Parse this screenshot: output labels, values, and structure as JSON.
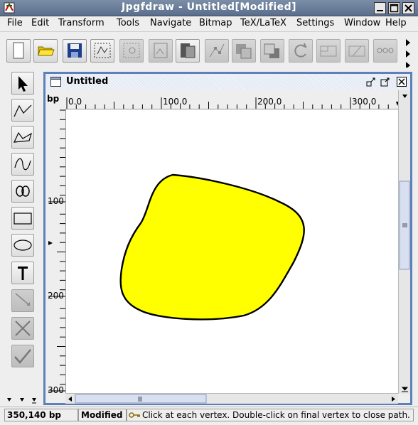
{
  "window": {
    "title": "Jpgfdraw - Untitled[Modified]"
  },
  "menu": [
    "File",
    "Edit",
    "Transform",
    "Tools",
    "Navigate",
    "Bitmap",
    "TeX/LaTeX",
    "Settings",
    "Window",
    "Help"
  ],
  "toolbar": {
    "buttons": [
      "new-document",
      "open-folder",
      "save-floppy",
      "select-all",
      "select-disabled",
      "insert-bitmap-disabled",
      "grid-disabled",
      "front-back",
      "edit-path-disabled",
      "move-to-front",
      "move-to-back",
      "rotate-disabled",
      "scale-disabled",
      "shear-disabled",
      "join-disabled"
    ]
  },
  "palette": {
    "tools": [
      "select-arrow",
      "open-line",
      "closed-line",
      "open-curve",
      "closed-curve",
      "rectangle",
      "ellipse",
      "text",
      "edit-path-disabled",
      "cancel-disabled",
      "finish-disabled"
    ]
  },
  "document": {
    "title": "Untitled",
    "units": "bp",
    "h_ticks": [
      "0.0",
      "100.0",
      "200.0",
      "300.0"
    ],
    "v_ticks": [
      "100",
      "200",
      "300"
    ],
    "shape": {
      "fill": "#ffff00",
      "stroke": "#000000"
    }
  },
  "status": {
    "position": "350,140 bp",
    "modified": "Modified",
    "message": "Click at each vertex. Double-click on final vertex to close path."
  },
  "colors": {
    "title_bar": "#5a6e8c",
    "frame_border": "#5e80ba",
    "shape_fill": "#ffff00"
  }
}
